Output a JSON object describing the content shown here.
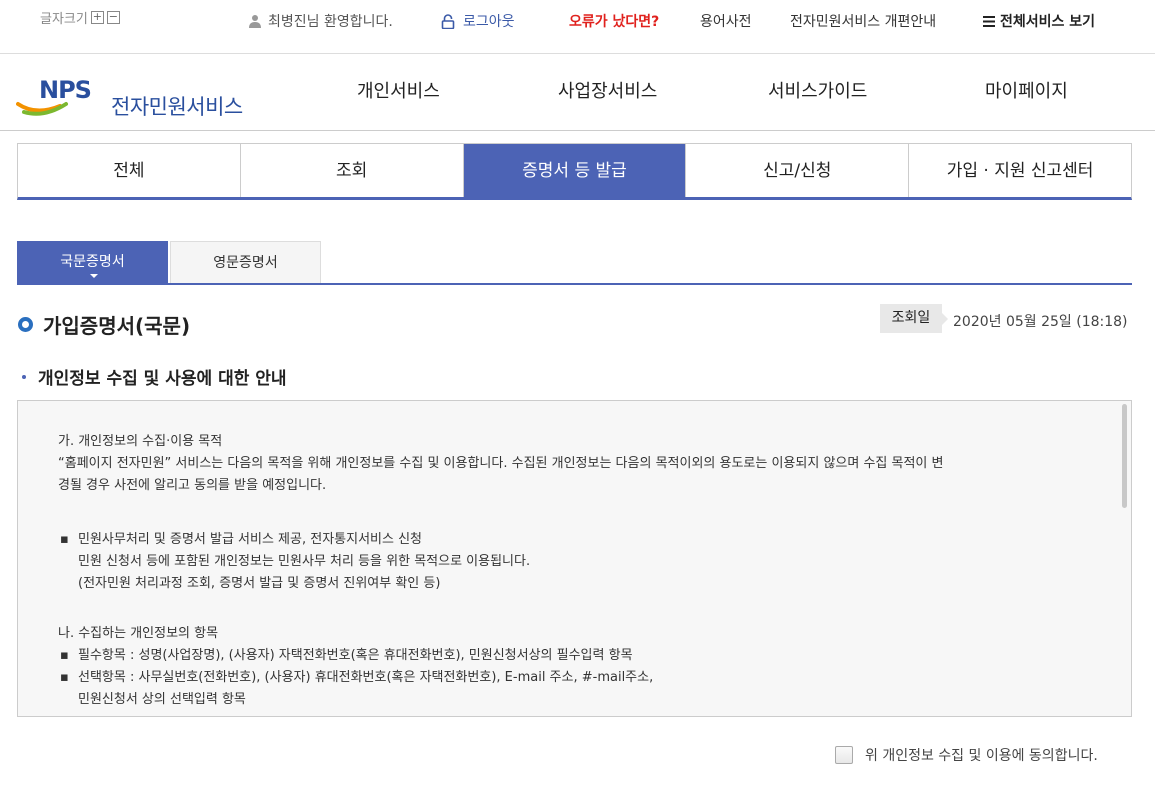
{
  "topbar": {
    "font_size_label": "글자크기",
    "font_plus": "+",
    "font_minus": "−",
    "welcome": "최병진님 환영합니다.",
    "logout": "로그아웃",
    "error_report": "오류가 났다면?",
    "glossary": "용어사전",
    "renewal_notice": "전자민원서비스 개편안내",
    "all_services": "전체서비스 보기"
  },
  "header": {
    "logo_text": "전자민원서비스",
    "logo_mark": "NPS",
    "nav": [
      "개인서비스",
      "사업장서비스",
      "서비스가이드",
      "마이페이지"
    ]
  },
  "category_tabs": {
    "items": [
      "전체",
      "조회",
      "증명서 등 발급",
      "신고/신청",
      "가입 · 지원 신고센터"
    ],
    "active_index": 2
  },
  "sub_tabs": {
    "items": [
      "국문증명서",
      "영문증명서"
    ],
    "active_index": 0
  },
  "page": {
    "title": "가입증명서(국문)",
    "date_label": "조회일",
    "date_value": "2020년 05월 25일 (18:18)"
  },
  "privacy": {
    "heading": "개인정보 수집 및 사용에 대한 안내",
    "section_a_title": "가. 개인정보의 수집·이용 목적",
    "section_a_line1": "“홈페이지 전자민원” 서비스는 다음의 목적을 위해 개인정보를 수집 및 이용합니다. 수집된 개인정보는 다음의 목적이외의 용도로는 이용되지 않으며 수집 목적이 변",
    "section_a_line2": "경될 경우 사전에 알리고 동의를 받을 예정입니다.",
    "bullet_mark": "▪",
    "purpose_line1": "민원사무처리 및 증명서 발급 서비스 제공, 전자통지서비스 신청",
    "purpose_line2": "민원 신청서 등에 포함된 개인정보는 민원사무 처리 등을 위한 목적으로 이용됩니다.",
    "purpose_line3": "(전자민원 처리과정 조회, 증명서 발급 및 증명서 진위여부 확인 등)",
    "section_b_title": "나. 수집하는 개인정보의 항목",
    "required_items": "필수항목 : 성명(사업장명), (사용자) 자택전화번호(혹은 휴대전화번호), 민원신청서상의 필수입력 항목",
    "optional_items_line1": "선택항목 : 사무실번호(전화번호), (사용자) 휴대전화번호(혹은 자택전화번호), E-mail 주소, #-mail주소,",
    "optional_items_line2": "민원신청서 상의 선택입력 항목",
    "agree_label": "위 개인정보 수집 및 이용에 동의합니다."
  },
  "colors": {
    "accent": "#4c63b5",
    "error": "#e0211d",
    "logo_blue": "#2a4f9e",
    "logo_orange": "#f39200",
    "logo_green": "#7cb82f"
  }
}
